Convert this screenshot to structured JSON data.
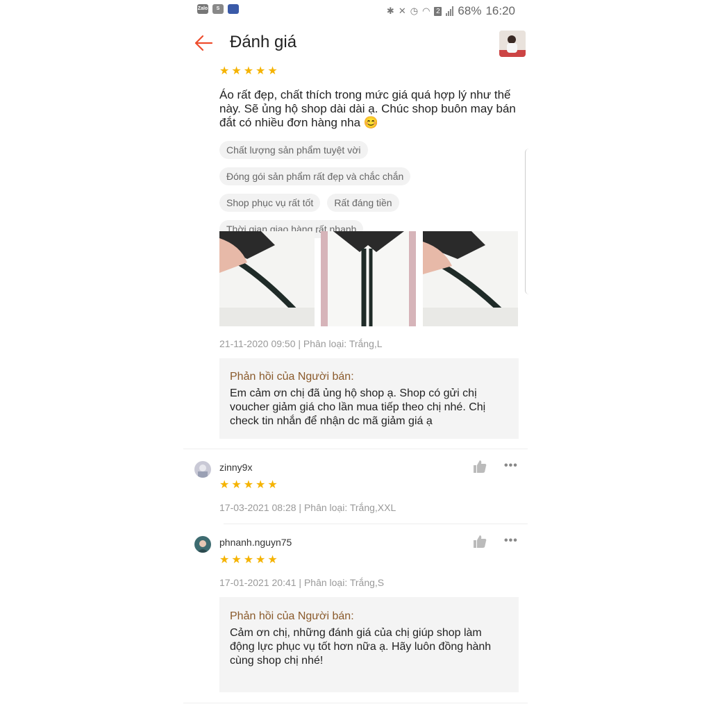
{
  "status": {
    "apps": [
      "Zalo",
      "S",
      ""
    ],
    "battery": "68%",
    "time": "16:20",
    "sim": "2"
  },
  "header": {
    "title": "Đánh giá"
  },
  "review1": {
    "stars": 5,
    "text": "Áo rất đẹp, chất thích trong mức giá quá hợp lý như thế này. Sẽ ủng hộ shop dài dài ạ. Chúc shop buôn may bán đắt có nhiều đơn hàng nha 😊",
    "tags": [
      "Chất lượng sản phẩm tuyệt vời",
      "Đóng gói sản phẩm rất đẹp và chắc chắn",
      "Shop phục vụ rất tốt",
      "Rất đáng tiền",
      "Thời gian giao hàng rất nhanh"
    ],
    "meta": "21-11-2020 09:50 | Phân loại: Trắng,L",
    "reply_title": "Phản hồi của Người bán:",
    "reply_text": "Em cảm ơn chị đã ủng hộ shop ạ. Shop có gửi chị voucher giảm giá cho lần mua tiếp theo chị nhé. Chị check tin nhắn để nhận dc mã giảm giá ạ"
  },
  "review2": {
    "username": "zinny9x",
    "stars": 5,
    "meta": "17-03-2021 08:28 | Phân loại: Trắng,XXL",
    "more": "•••"
  },
  "review3": {
    "username": "phnanh.nguyn75",
    "stars": 5,
    "meta": "17-01-2021 20:41 | Phân loại: Trắng,S",
    "more": "•••",
    "reply_title": "Phản hồi của Người bán:",
    "reply_text": "Cảm ơn chị, những đánh giá của chị giúp shop làm động lực phục vụ tốt hơn nữa ạ. Hãy luôn đồng hành cùng shop chị nhé!"
  },
  "colors": {
    "accent": "#ee4d2d",
    "star": "#f5b301",
    "reply_title": "#8a5a2b"
  }
}
